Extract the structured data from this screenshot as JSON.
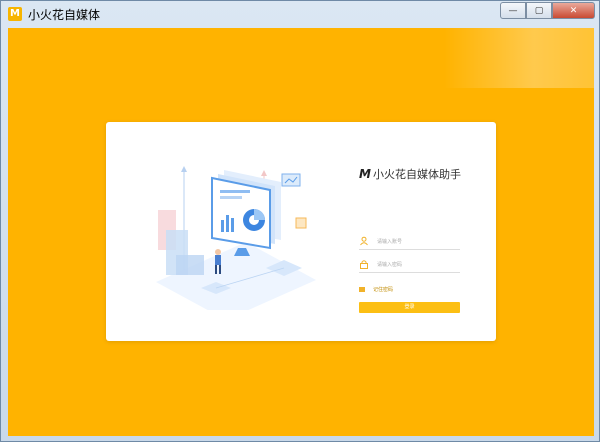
{
  "window": {
    "title": "小火花自媒体",
    "icon_letter": "M",
    "buttons": {
      "minimize": "—",
      "maximize": "▢",
      "close": "✕"
    }
  },
  "colors": {
    "accent": "#ffb300",
    "button": "#fcbf14"
  },
  "login": {
    "brand_logo": "M",
    "brand_name": "小火花自媒体助手",
    "account_placeholder": "请输入账号",
    "password_placeholder": "请输入密码",
    "remember_label": "记住密码",
    "login_label": "登录"
  },
  "icons": {
    "account": "user-icon",
    "password": "lock-icon",
    "remember": "checkbox-icon"
  }
}
